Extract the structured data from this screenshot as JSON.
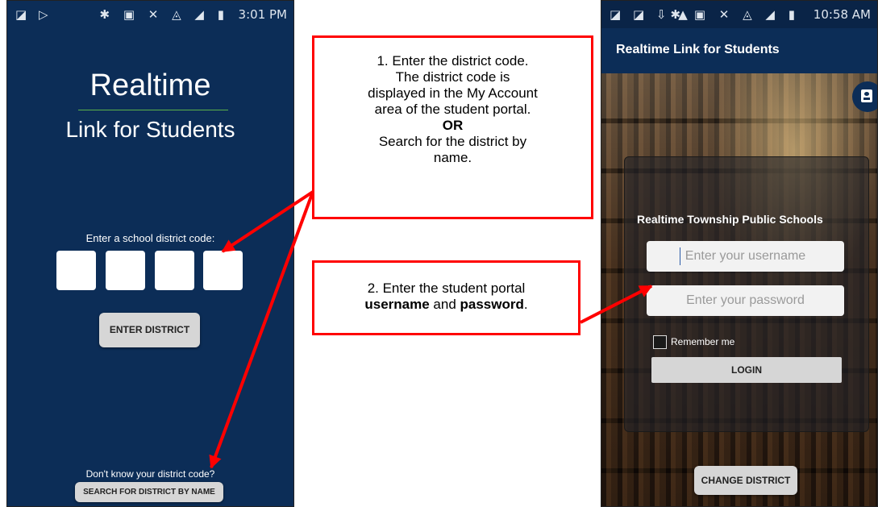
{
  "left_phone": {
    "status_time": "3:01 PM",
    "status_left_icons": "◪ ▷",
    "status_right_icons": "✱ ▣ ✕ ◬ ◢ ▮",
    "brand_title": "Realtime",
    "brand_subtitle": "Link for Students",
    "code_label": "Enter a school district code:",
    "enter_district_button": "ENTER DISTRICT",
    "dont_know_label": "Don't know your district code?",
    "search_button": "SEARCH FOR DISTRICT BY NAME"
  },
  "callout1": {
    "line1": "1. Enter the district code.",
    "line2": "The district code is",
    "line3": "displayed in the My Account",
    "line4": "area of the student portal.",
    "or": "OR",
    "line5": "Search for the district by",
    "line6": "name."
  },
  "callout2": {
    "line1": "2. Enter the student portal",
    "username": "username",
    "and": " and ",
    "password": "password",
    "period": "."
  },
  "right_phone": {
    "status_time": "10:58 AM",
    "status_left_icons": "◪ ◪ ⇩ ▲",
    "status_right_icons": "✱ ▣ ✕ ◬ ◢ ▮",
    "app_title": "Realtime Link for Students",
    "district_name": "Realtime Township Public Schools",
    "username_placeholder": "Enter your username",
    "password_placeholder": "Enter your password",
    "remember_label": "Remember me",
    "login_button": "LOGIN",
    "change_district_button": "CHANGE DISTRICT"
  },
  "colors": {
    "app_navy": "#0c2d57",
    "accent_green": "#5bb24a",
    "annotation_red": "#ff0000"
  },
  "icons": [
    "account-icon",
    "checkbox-icon",
    "arrow-icon"
  ]
}
